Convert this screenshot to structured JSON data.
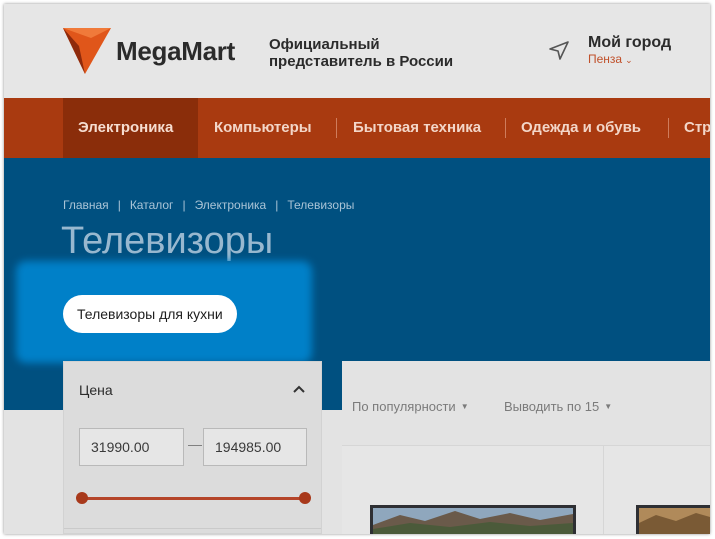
{
  "header": {
    "logo_text": "MegaMart",
    "tagline_line1": "Официальный",
    "tagline_line2": "представитель в России",
    "city_title": "Мой город",
    "city_name": "Пенза",
    "city_icon": "location-arrow-icon",
    "colors": {
      "logo_orange": "#e0561a",
      "logo_dark": "#8e2a0c"
    }
  },
  "nav": {
    "items": [
      {
        "label": "Электроника",
        "active": true
      },
      {
        "label": "Компьютеры",
        "active": false
      },
      {
        "label": "Бытовая техника",
        "active": false
      },
      {
        "label": "Одежда и обувь",
        "active": false
      },
      {
        "label": "Стр",
        "active": false
      }
    ],
    "colors": {
      "background": "#a93a10",
      "active": "#8a2d0a"
    }
  },
  "banner": {
    "breadcrumbs": [
      "Главная",
      "Каталог",
      "Электроника",
      "Телевизоры"
    ],
    "title": "Телевизоры",
    "chip_label": "Телевизоры для кухни",
    "colors": {
      "background": "#005080",
      "highlight": "#0080c8"
    }
  },
  "filters": {
    "price": {
      "title": "Цена",
      "min_value": "31990.00",
      "max_value": "194985.00",
      "dash": "—",
      "range_fill": 1.0,
      "caret_icon": "chevron-up-icon"
    }
  },
  "listing": {
    "sort_label": "По популярности",
    "per_page_label": "Выводить по 15"
  }
}
